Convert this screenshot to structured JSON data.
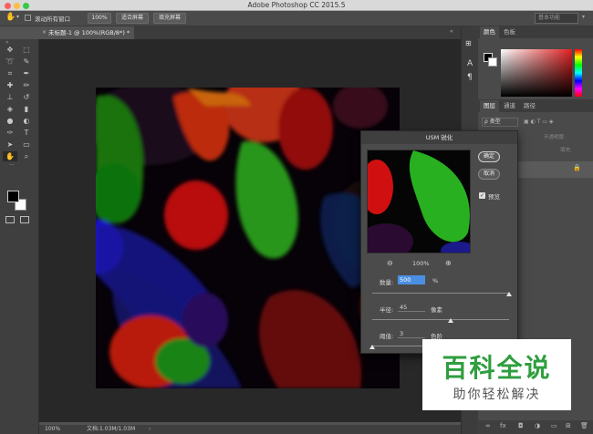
{
  "app": {
    "title": "Adobe Photoshop CC 2015.5"
  },
  "options_bar": {
    "scroll_all_label": "滚动所有窗口",
    "zoom_value": "100%",
    "fit_screen_label": "适合屏幕",
    "fill_screen_label": "填充屏幕",
    "workspace_label": "基本功能"
  },
  "document": {
    "tab_title": "未标题-1 @ 100%(RGB/8*) *"
  },
  "status_bar": {
    "zoom": "100%",
    "doc_info": "文档:1.03M/1.03M"
  },
  "panels": {
    "top_tabs": [
      "颜色",
      "色板"
    ],
    "layer_tabs": [
      "图层",
      "通道",
      "路径"
    ],
    "kind_label": "ρ 类型",
    "opacity_label": "不透明度:",
    "fill_label": "填充:",
    "layer_name": "背景"
  },
  "dialog": {
    "title": "USM 锐化",
    "ok_label": "确定",
    "cancel_label": "取消",
    "preview_label": "预览",
    "zoom_label": "100%",
    "amount_label": "数量:",
    "amount_value": "500",
    "amount_unit": "%",
    "radius_label": "半径:",
    "radius_value": "45",
    "radius_unit": "像素",
    "threshold_label": "阈值:",
    "threshold_value": "3",
    "threshold_unit": "色阶",
    "amount_level": 1.0,
    "radius_level": 0.57,
    "threshold_level": 0.0
  },
  "watermark": {
    "title": "百科全说",
    "subtitle": "助你轻松解决"
  },
  "colors": {
    "accent": "#4a90e2",
    "panel_bg": "#4a4a4a",
    "canvas_bg": "#282828",
    "watermark_green": "#2e9e3e"
  }
}
